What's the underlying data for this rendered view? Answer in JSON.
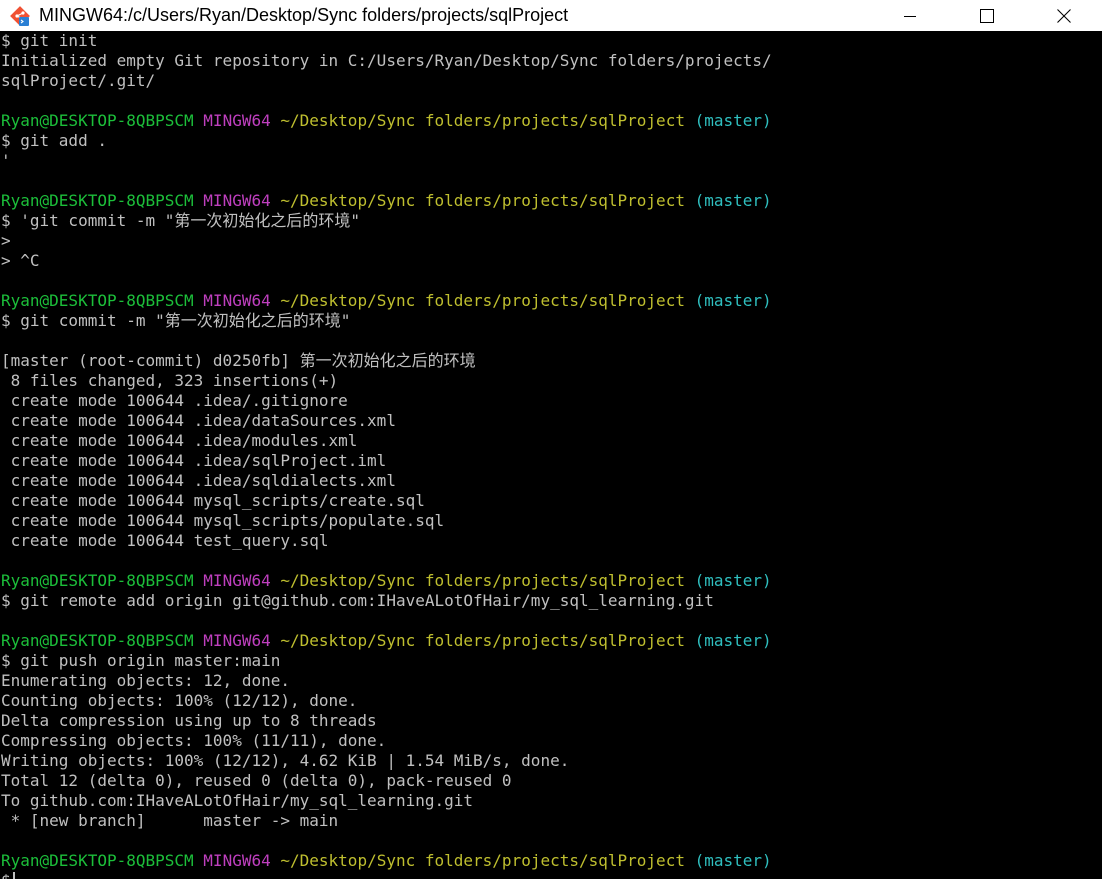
{
  "window": {
    "title": "MINGW64:/c/Users/Ryan/Desktop/Sync folders/projects/sqlProject",
    "icon": "git-bash-icon",
    "controls": {
      "minimize": "minimize-icon",
      "maximize": "maximize-icon",
      "close": "close-icon"
    }
  },
  "colors": {
    "background": "#000000",
    "text": "#c0c0c0",
    "user_host": "#1cbf3a",
    "mingw": "#bf3fbf",
    "path": "#bfbf2f",
    "branch": "#2fbfbf"
  },
  "prompt": {
    "user_host": "Ryan@DESKTOP-8QBPSCM",
    "system": "MINGW64",
    "path": "~/Desktop/Sync folders/projects/sqlProject",
    "branch": "(master)",
    "symbol": "$"
  },
  "terminal_lines": [
    {
      "type": "text",
      "text": "$ git init"
    },
    {
      "type": "text",
      "text": "Initialized empty Git repository in C:/Users/Ryan/Desktop/Sync folders/projects/"
    },
    {
      "type": "text",
      "text": "sqlProject/.git/"
    },
    {
      "type": "blank"
    },
    {
      "type": "prompt"
    },
    {
      "type": "text",
      "text": "$ git add ."
    },
    {
      "type": "text",
      "text": "'"
    },
    {
      "type": "blank"
    },
    {
      "type": "prompt"
    },
    {
      "type": "text",
      "text": "$ 'git commit -m \"第一次初始化之后的环境\""
    },
    {
      "type": "text",
      "text": ">"
    },
    {
      "type": "text",
      "text": "> ^C"
    },
    {
      "type": "blank"
    },
    {
      "type": "prompt"
    },
    {
      "type": "text",
      "text": "$ git commit -m \"第一次初始化之后的环境\""
    },
    {
      "type": "blank"
    },
    {
      "type": "text",
      "text": "[master (root-commit) d0250fb] 第一次初始化之后的环境"
    },
    {
      "type": "text",
      "text": " 8 files changed, 323 insertions(+)"
    },
    {
      "type": "text",
      "text": " create mode 100644 .idea/.gitignore"
    },
    {
      "type": "text",
      "text": " create mode 100644 .idea/dataSources.xml"
    },
    {
      "type": "text",
      "text": " create mode 100644 .idea/modules.xml"
    },
    {
      "type": "text",
      "text": " create mode 100644 .idea/sqlProject.iml"
    },
    {
      "type": "text",
      "text": " create mode 100644 .idea/sqldialects.xml"
    },
    {
      "type": "text",
      "text": " create mode 100644 mysql_scripts/create.sql"
    },
    {
      "type": "text",
      "text": " create mode 100644 mysql_scripts/populate.sql"
    },
    {
      "type": "text",
      "text": " create mode 100644 test_query.sql"
    },
    {
      "type": "blank"
    },
    {
      "type": "prompt"
    },
    {
      "type": "text",
      "text": "$ git remote add origin git@github.com:IHaveALotOfHair/my_sql_learning.git"
    },
    {
      "type": "blank"
    },
    {
      "type": "prompt"
    },
    {
      "type": "text",
      "text": "$ git push origin master:main"
    },
    {
      "type": "text",
      "text": "Enumerating objects: 12, done."
    },
    {
      "type": "text",
      "text": "Counting objects: 100% (12/12), done."
    },
    {
      "type": "text",
      "text": "Delta compression using up to 8 threads"
    },
    {
      "type": "text",
      "text": "Compressing objects: 100% (11/11), done."
    },
    {
      "type": "text",
      "text": "Writing objects: 100% (12/12), 4.62 KiB | 1.54 MiB/s, done."
    },
    {
      "type": "text",
      "text": "Total 12 (delta 0), reused 0 (delta 0), pack-reused 0"
    },
    {
      "type": "text",
      "text": "To github.com:IHaveALotOfHair/my_sql_learning.git"
    },
    {
      "type": "text",
      "text": " * [new branch]      master -> main"
    },
    {
      "type": "blank"
    },
    {
      "type": "prompt"
    },
    {
      "type": "input",
      "text": "$ "
    }
  ]
}
